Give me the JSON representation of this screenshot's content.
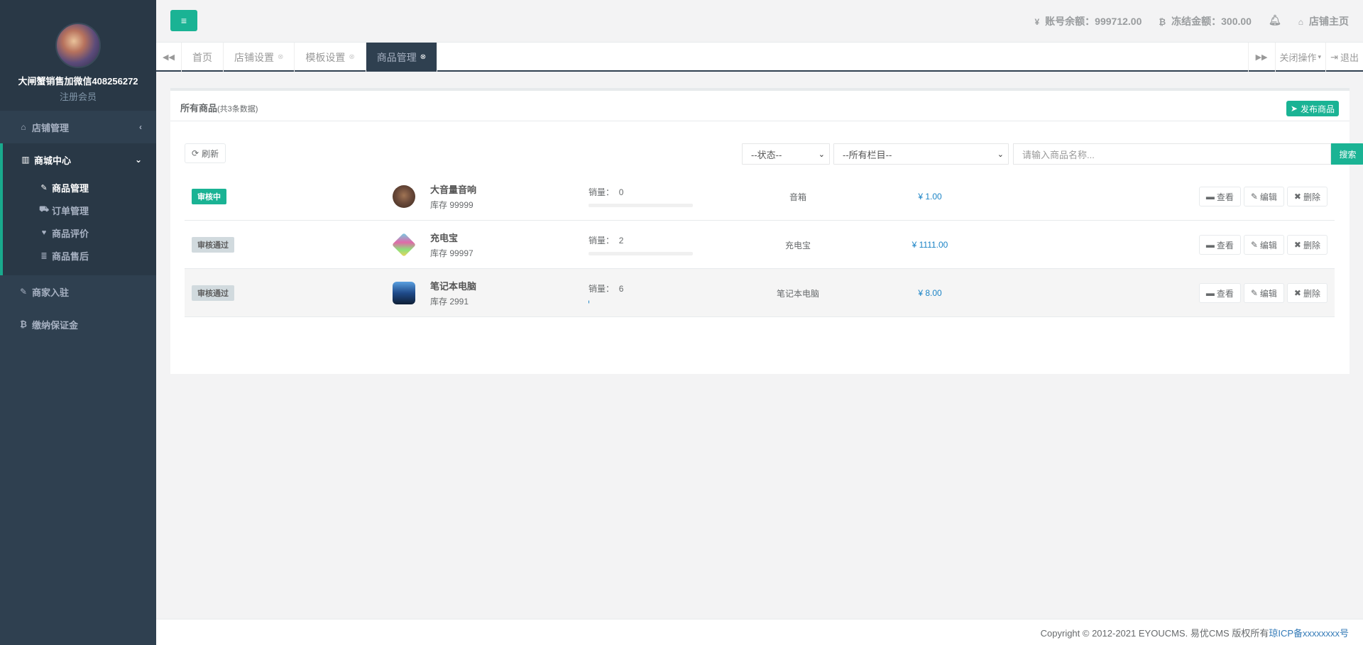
{
  "sidebar": {
    "user_name": "大闸蟹销售加微信408256272",
    "user_role": "注册会员",
    "items": [
      {
        "label": "店铺管理",
        "icon": "home-icon",
        "arrow": "‹"
      },
      {
        "label": "商城中心",
        "icon": "bar-chart-icon",
        "arrow": "⌄"
      },
      {
        "label": "商家入驻",
        "icon": "edit-icon"
      },
      {
        "label": "缴纳保证金",
        "icon": "bitcoin-icon"
      }
    ],
    "sub_items": [
      {
        "label": "商品管理",
        "icon": "edit-square-icon"
      },
      {
        "label": "订单管理",
        "icon": "cart-icon"
      },
      {
        "label": "商品评价",
        "icon": "heart-icon"
      },
      {
        "label": "商品售后",
        "icon": "database-icon"
      }
    ]
  },
  "topbar": {
    "balance": "账号余额：999712.00",
    "frozen": "冻结金额：300.00",
    "store_home": "店铺主页"
  },
  "tabs": [
    {
      "label": "首页",
      "closable": false
    },
    {
      "label": "店铺设置",
      "closable": true
    },
    {
      "label": "模板设置",
      "closable": true
    },
    {
      "label": "商品管理",
      "closable": true
    }
  ],
  "tabs_right": {
    "close_ops": "关闭操作",
    "logout": "退出"
  },
  "panel": {
    "title": "所有商品",
    "count": "(共3条数据)",
    "publish_label": "发布商品",
    "refresh_label": "刷新",
    "status_select": "--状态--",
    "column_select": "--所有栏目--",
    "search_placeholder": "请输入商品名称...",
    "search_label": "搜索"
  },
  "products": [
    {
      "status": "审核中",
      "status_type": "pending",
      "name": "大音量音响",
      "stock": "库存 99999",
      "sales_label": "销量：",
      "sales": "0",
      "sales_fill": 0.0,
      "category": "音箱",
      "price": "¥ 1.00",
      "thumb_color": "#6b4a3a"
    },
    {
      "status": "审核通过",
      "status_type": "passed",
      "name": "充电宝",
      "stock": "库存 99997",
      "sales_label": "销量：",
      "sales": "2",
      "sales_fill": 0.0,
      "category": "充电宝",
      "price": "¥ 1111.00",
      "thumb_color": "#e06aa8"
    },
    {
      "status": "审核通过",
      "status_type": "passed",
      "name": "笔记本电脑",
      "stock": "库存 2991",
      "sales_label": "销量：",
      "sales": "6",
      "sales_fill": 0.01,
      "category": "笔记本电脑",
      "price": "¥ 8.00",
      "thumb_color": "#1f4a8a"
    }
  ],
  "row_actions": {
    "view": "查看",
    "edit": "编辑",
    "delete": "删除"
  },
  "footer": {
    "copyright": "Copyright © 2012-2021 EYOUCMS. 易优CMS 版权所有",
    "icp": "琼ICP备xxxxxxxx号"
  },
  "colors": {
    "accent": "#1ab394",
    "sidebar": "#2f4050",
    "link": "#1c84c6"
  }
}
